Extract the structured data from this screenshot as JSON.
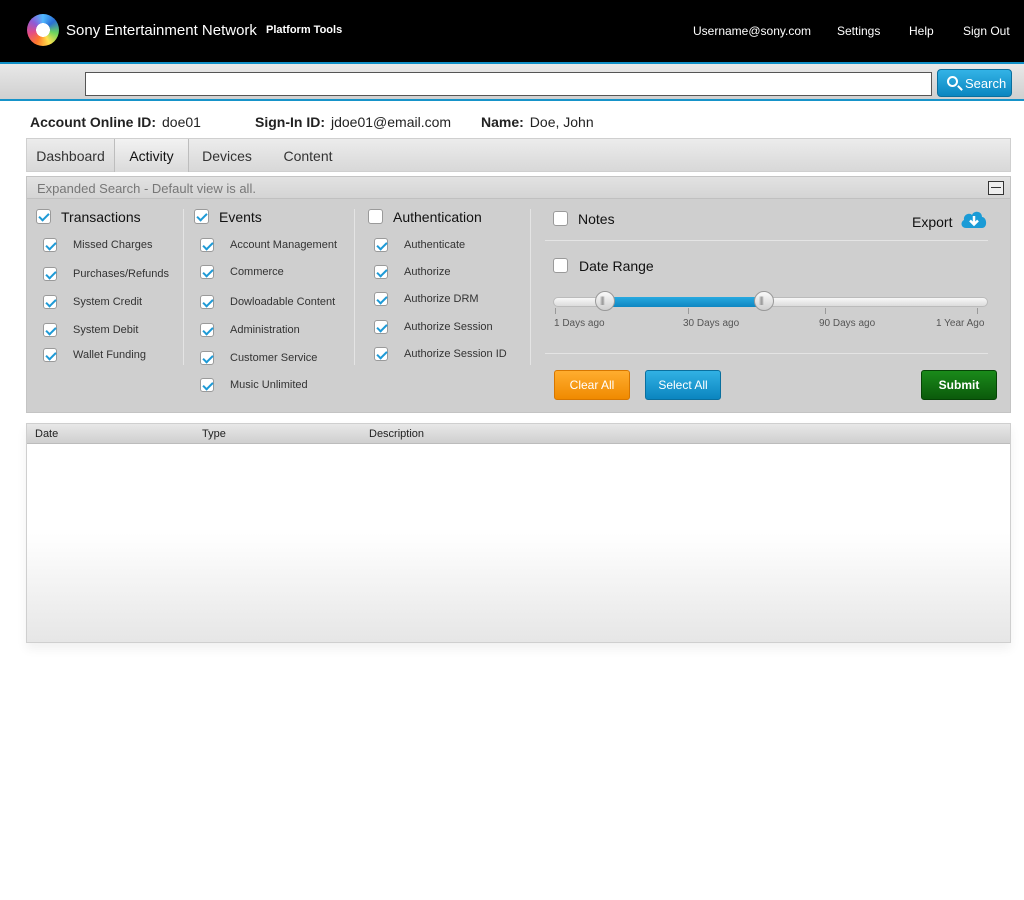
{
  "header": {
    "brand": "Sony Entertainment Network",
    "platform": "Platform Tools",
    "nav": [
      "Username@sony.com",
      "Settings",
      "Help",
      "Sign Out"
    ]
  },
  "search": {
    "value": "",
    "placeholder": "",
    "button_label": "Search"
  },
  "account": {
    "online_id_label": "Account Online ID:",
    "online_id": "doe01",
    "signin_label": "Sign-In ID:",
    "signin_id": "jdoe01@email.com",
    "name_label": "Name:",
    "name": "Doe, John"
  },
  "tabs": [
    {
      "label": "Dashboard",
      "active": false
    },
    {
      "label": "Activity",
      "active": true
    },
    {
      "label": "Devices",
      "active": false
    },
    {
      "label": "Content",
      "active": false
    }
  ],
  "panel": {
    "title": "Expanded Search - Default view is all.",
    "transactions": {
      "label": "Transactions",
      "checked": true,
      "items": [
        {
          "label": "Missed Charges",
          "checked": true
        },
        {
          "label": "Purchases/Refunds",
          "checked": true
        },
        {
          "label": "System Credit",
          "checked": true
        },
        {
          "label": "System Debit",
          "checked": true
        },
        {
          "label": "Wallet Funding",
          "checked": true
        }
      ]
    },
    "events": {
      "label": "Events",
      "checked": true,
      "items": [
        {
          "label": "Account Management",
          "checked": true
        },
        {
          "label": "Commerce",
          "checked": true
        },
        {
          "label": "Dowloadable Content",
          "checked": true
        },
        {
          "label": "Administration",
          "checked": true
        },
        {
          "label": "Customer Service",
          "checked": true
        },
        {
          "label": "Music Unlimited",
          "checked": true
        }
      ]
    },
    "authentication": {
      "label": "Authentication",
      "checked": false,
      "items": [
        {
          "label": "Authenticate",
          "checked": true
        },
        {
          "label": "Authorize",
          "checked": true
        },
        {
          "label": "Authorize DRM",
          "checked": true
        },
        {
          "label": "Authorize Session",
          "checked": true
        },
        {
          "label": "Authorize Session ID",
          "checked": true
        }
      ]
    },
    "notes": {
      "label": "Notes",
      "checked": false
    },
    "export_label": "Export",
    "date_range": {
      "label": "Date Range",
      "checked": false,
      "ticks": [
        "1 Days ago",
        "30 Days ago",
        "90 Days ago",
        "1 Year Ago"
      ]
    },
    "buttons": {
      "clear": "Clear All",
      "select": "Select All",
      "submit": "Submit"
    }
  },
  "results": {
    "columns": [
      "Date",
      "Type",
      "Description"
    ]
  },
  "colors": {
    "accent": "#1693c9",
    "orange": "#f08a00",
    "green": "#0b5a0b"
  }
}
